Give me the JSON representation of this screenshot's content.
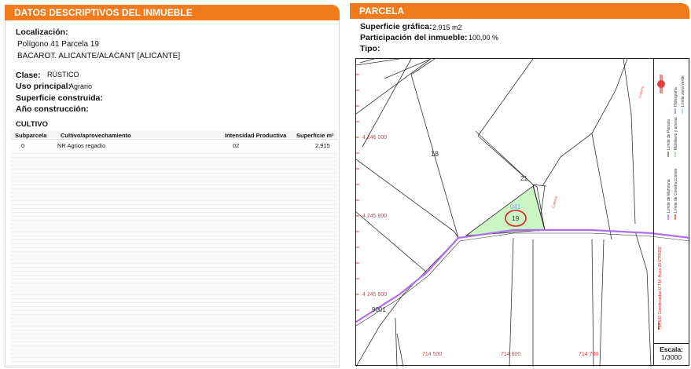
{
  "left_panel": {
    "title": "DATOS DESCRIPTIVOS DEL INMUEBLE",
    "localizacion_label": "Localización:",
    "localizacion_line1": "Polígono 41 Parcela 19",
    "localizacion_line2": "BACAROT. ALICANTE/ALACANT [ALICANTE]",
    "clase_label": "Clase:",
    "clase_value": "RÚSTICO",
    "uso_label": "Uso principal:",
    "uso_value": "Agrario",
    "superficie_label": "Superficie construida:",
    "anio_label": "Año construcción:",
    "cultivo_title": "CULTIVO",
    "table": {
      "headers": [
        "Subparcela",
        "Cultivo/aprovechamiento",
        "Intensidad Productiva",
        "Superficie m²"
      ],
      "rows": [
        [
          "0",
          "NR Agrios regadío",
          "02",
          "2.915"
        ]
      ]
    }
  },
  "right_panel": {
    "title": "PARCELA",
    "superficie_label": "Superficie gráfica:",
    "superficie_value": "2.915 m2",
    "participacion_label": "Participación del inmueble:",
    "participacion_value": "100,00 %",
    "tipo_label": "Tipo:",
    "map": {
      "northing_labels": [
        "4 246 000",
        "4 245 800",
        "4 245 600"
      ],
      "easting_labels": [
        "714 500",
        "714 600",
        "714 700"
      ],
      "parcel_labels": [
        "18",
        "21",
        "041",
        "19",
        "9001"
      ],
      "vertical_labels": [
        "Camino",
        "Camino"
      ],
      "legend_items": [
        "Límite de Manzana",
        "Límite de Parcela",
        "Límite de Construcciones",
        "Mobiliario y aceras",
        "Límite zona verde",
        "Hidrografía"
      ],
      "side_note": "714.600 Coordenadas U.T.M. Huso 30 ETRS89",
      "scale_label": "Escala:",
      "scale_value": "1/3000",
      "colors": {
        "parcel_fill": "#ccf5c4",
        "highlight": "#d62020",
        "road": "#b26cf0",
        "grid_label": "#e04040"
      }
    }
  }
}
